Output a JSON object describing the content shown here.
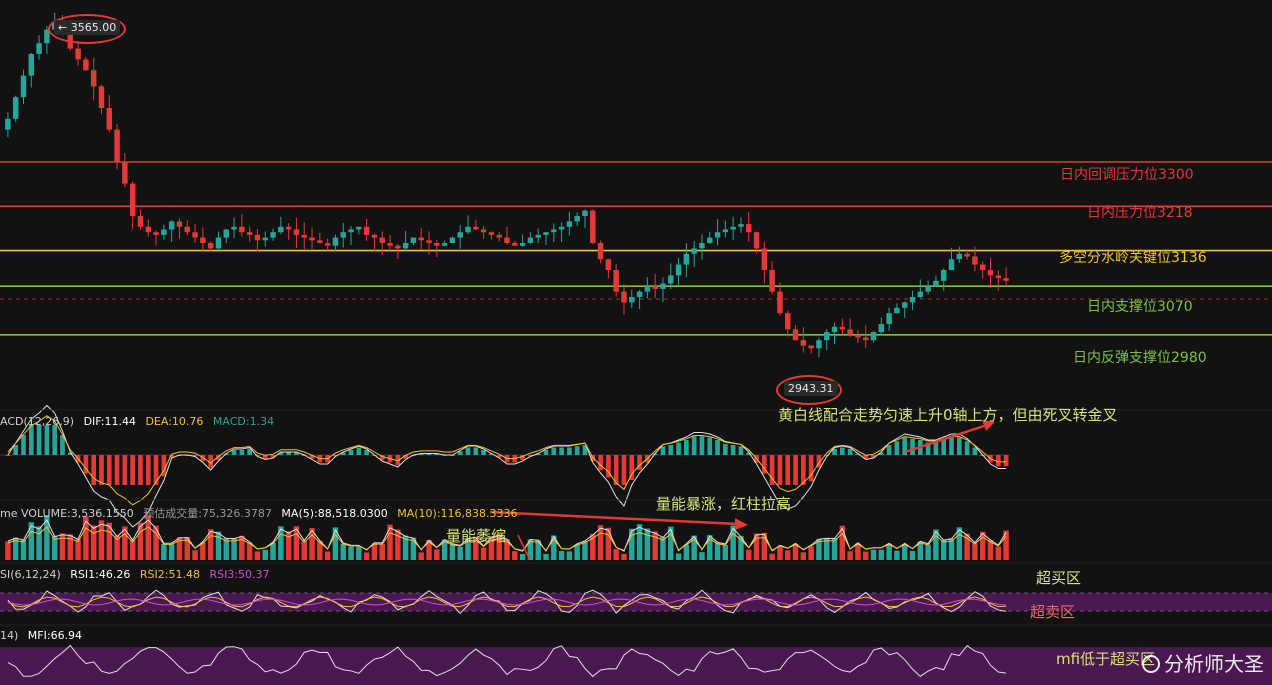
{
  "levels": [
    {
      "label": "日内回调压力位3300",
      "value": 3300,
      "color": "#e53935"
    },
    {
      "label": "日内压力位3218",
      "value": 3218,
      "color": "#e53935"
    },
    {
      "label": "多空分水岭关键位3136",
      "value": 3136,
      "color": "#f2c12e"
    },
    {
      "label": "日内支撑位3070",
      "value": 3070,
      "color": "#7cc242"
    },
    {
      "label": "日内反弹支撑位2980",
      "value": 2980,
      "color": "#7cc242"
    }
  ],
  "annotations": {
    "high_label": "← 3565.00",
    "low_label": "2943.31",
    "macd_note": "黄白线配合走势匀速上升0轴上方，但由死叉转金叉",
    "volume_surge": "量能暴涨，红柱拉高",
    "volume_shrink": "量能萎缩",
    "overbought": "超买区",
    "oversold": "超卖区",
    "mfi_note": "mfi低于超买区"
  },
  "indicators": {
    "macd": {
      "name": "ACD(12,26,9)",
      "dif": "DIF:11.44",
      "dea": "DEA:10.76",
      "macd": "MACD:1.34"
    },
    "volume": {
      "name": "me VOLUME:3,536.1550",
      "est": "预估成交量:75,326.3787",
      "ma5": "MA(5):88,518.0300",
      "ma10": "MA(10):116,838.3336"
    },
    "rsi": {
      "name": "SI(6,12,24)",
      "rsi1": "RSI1:46.26",
      "rsi2": "RSI2:51.48",
      "rsi3": "RSI3:50.37"
    },
    "mfi": {
      "name": "14)",
      "value": "MFI:66.94"
    }
  },
  "watermark": "分析师大圣",
  "colors": {
    "up": "#26a69a",
    "down": "#e53935",
    "yellow": "#f2c12e",
    "white": "#e0e0e0",
    "purple": "#4a1850"
  },
  "chart_data": {
    "type": "candlestick",
    "series_close": [
      3380,
      3420,
      3460,
      3500,
      3520,
      3545,
      3560,
      3540,
      3510,
      3490,
      3470,
      3440,
      3400,
      3360,
      3300,
      3260,
      3200,
      3180,
      3170,
      3165,
      3175,
      3190,
      3180,
      3170,
      3160,
      3150,
      3140,
      3160,
      3175,
      3180,
      3170,
      3165,
      3155,
      3160,
      3170,
      3180,
      3175,
      3165,
      3160,
      3155,
      3150,
      3145,
      3160,
      3170,
      3175,
      3180,
      3165,
      3160,
      3150,
      3145,
      3140,
      3150,
      3160,
      3155,
      3150,
      3145,
      3150,
      3160,
      3170,
      3180,
      3175,
      3170,
      3165,
      3160,
      3150,
      3145,
      3150,
      3160,
      3165,
      3170,
      3175,
      3180,
      3190,
      3200,
      3210,
      3150,
      3120,
      3100,
      3060,
      3040,
      3050,
      3060,
      3070,
      3065,
      3075,
      3090,
      3110,
      3130,
      3140,
      3150,
      3160,
      3170,
      3175,
      3180,
      3185,
      3170,
      3140,
      3100,
      3060,
      3020,
      2990,
      2970,
      2960,
      2955,
      2970,
      2985,
      2995,
      2990,
      2980,
      2975,
      2970,
      2985,
      3000,
      3020,
      3030,
      3040,
      3050,
      3060,
      3070,
      3080,
      3100,
      3120,
      3130,
      3125,
      3110,
      3100,
      3090,
      3085,
      3080
    ],
    "high": 3565.0,
    "low": 2943.31,
    "ylim": [
      2850,
      3600
    ]
  }
}
